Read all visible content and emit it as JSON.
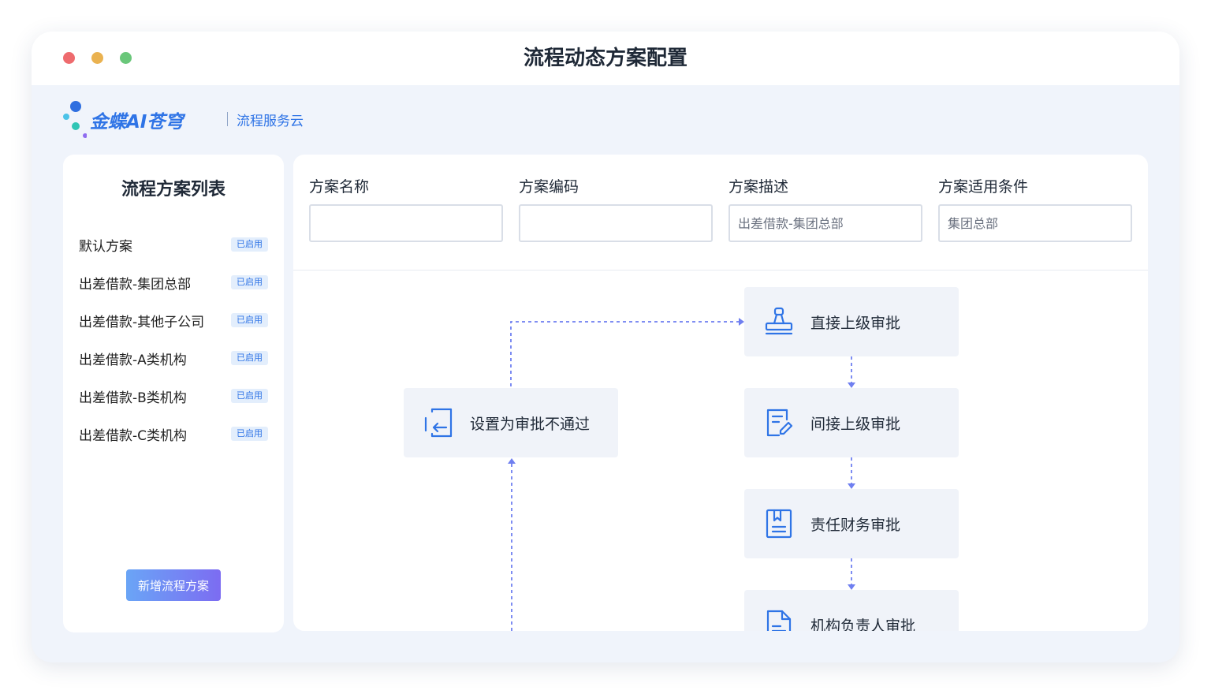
{
  "window": {
    "title": "流程动态方案配置"
  },
  "brand": {
    "name": "金蝶AI苍穹",
    "subtitle": "流程服务云"
  },
  "sidebar": {
    "title": "流程方案列表",
    "items": [
      {
        "label": "默认方案",
        "status": "已启用"
      },
      {
        "label": "出差借款-集团总部",
        "status": "已启用"
      },
      {
        "label": "出差借款-其他子公司",
        "status": "已启用"
      },
      {
        "label": "出差借款-A类机构",
        "status": "已启用"
      },
      {
        "label": "出差借款-B类机构",
        "status": "已启用"
      },
      {
        "label": "出差借款-C类机构",
        "status": "已启用"
      }
    ],
    "add_button": "新增流程方案"
  },
  "form": {
    "fields": [
      {
        "label": "方案名称",
        "value": "",
        "placeholder": ""
      },
      {
        "label": "方案编码",
        "value": "",
        "placeholder": ""
      },
      {
        "label": "方案描述",
        "value": "",
        "placeholder": "出差借款-集团总部"
      },
      {
        "label": "方案适用条件",
        "value": "",
        "placeholder": "集团总部"
      }
    ]
  },
  "flow": {
    "nodes": [
      {
        "label": "直接上级审批",
        "icon": "stamp-icon"
      },
      {
        "label": "间接上级审批",
        "icon": "edit-document-icon"
      },
      {
        "label": "责任财务审批",
        "icon": "bookmark-document-icon"
      },
      {
        "label": "机构负责人审批",
        "icon": "document-icon"
      },
      {
        "label": "设置为审批不通过",
        "icon": "return-icon"
      }
    ]
  },
  "colors": {
    "accent": "#2f74e6",
    "connector": "#6f7ff0",
    "node_bg": "#f0f3f9",
    "icon": "#2f74e6"
  }
}
